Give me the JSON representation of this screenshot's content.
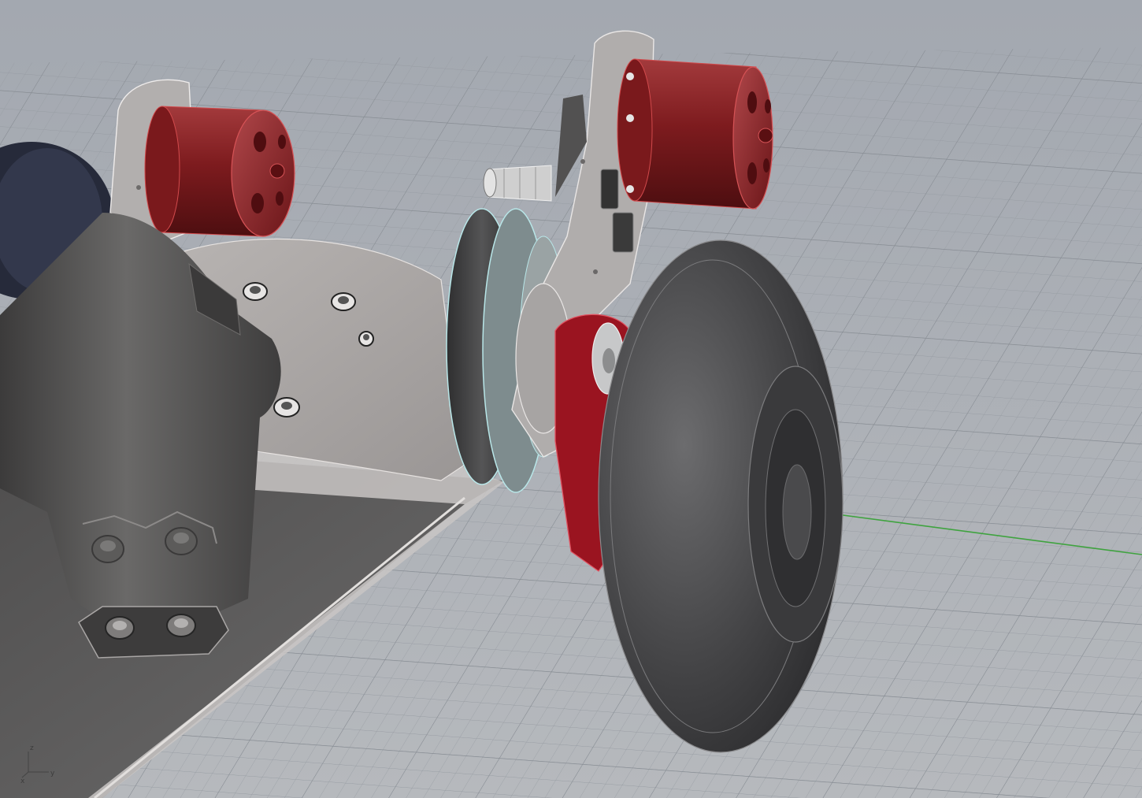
{
  "viewport": {
    "display_mode": "shaded",
    "background_color": "#a9adb4",
    "grid_color": "#8f949b",
    "grid_major_color": "#7c8188",
    "world_y_axis_color": "#3fa33f"
  },
  "axis_widget": {
    "z_label": "z",
    "y_label": "y",
    "x_label": "x"
  },
  "model": {
    "motor_color": "#8a1e22",
    "idler_arm_color": "#9a1420",
    "tire_color": "#4a4a4c",
    "bracket_color": "#a7a4a3",
    "edge_highlight_color": "#b8e6e8"
  }
}
